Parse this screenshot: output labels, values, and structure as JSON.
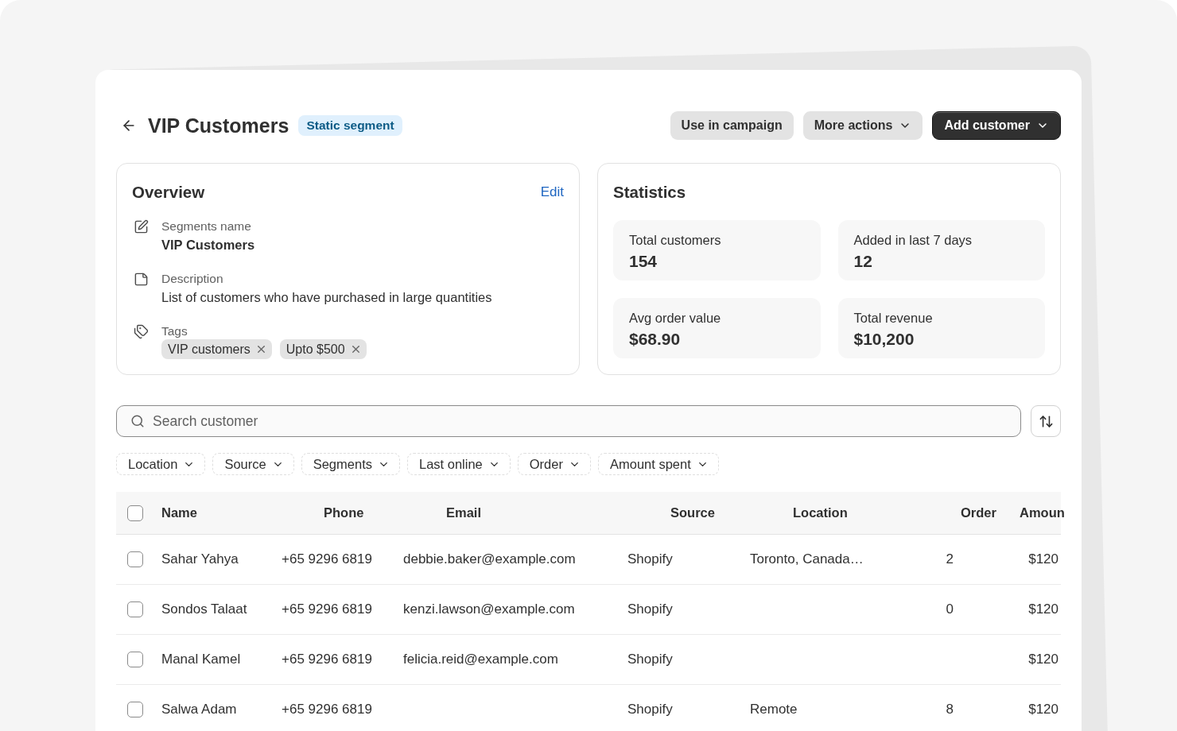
{
  "header": {
    "title": "VIP Customers",
    "badge": "Static segment",
    "actions": [
      {
        "label": "Use in campaign",
        "kind": "secondary",
        "caret": false
      },
      {
        "label": "More actions",
        "kind": "secondary",
        "caret": true
      },
      {
        "label": "Add customer",
        "kind": "primary",
        "caret": true
      }
    ]
  },
  "overview": {
    "title": "Overview",
    "edit_link": "Edit",
    "fields": [
      {
        "kind": "name",
        "label": "Segments name",
        "value": "VIP Customers"
      },
      {
        "kind": "description",
        "label": "Description",
        "value": "List of customers who have purchased in large quantities"
      },
      {
        "kind": "tags",
        "label": "Tags",
        "tags": [
          "VIP customers",
          "Upto $500"
        ]
      }
    ]
  },
  "statistics": {
    "title": "Statistics",
    "tiles": [
      {
        "label": "Total customers",
        "value": "154"
      },
      {
        "label": "Added in last 7 days",
        "value": "12"
      },
      {
        "label": "Avg order value",
        "value": "$68.90"
      },
      {
        "label": "Total revenue",
        "value": "$10,200"
      }
    ]
  },
  "search": {
    "placeholder": "Search customer"
  },
  "filters": [
    "Location",
    "Source",
    "Segments",
    "Last online",
    "Order",
    "Amount spent"
  ],
  "table": {
    "all_checked": false,
    "columns": [
      "Name",
      "Phone",
      "Email",
      "Source",
      "Location",
      "Order",
      "Amoun"
    ],
    "rows": [
      {
        "checked": false,
        "name": "Sahar Yahya",
        "phone": "+65 9296 6819",
        "email": "debbie.baker@example.com",
        "source": "Shopify",
        "location": "Toronto, Canada…",
        "order": "2",
        "amount": "$120"
      },
      {
        "checked": false,
        "name": "Sondos Talaat",
        "phone": "+65 9296 6819",
        "email": "kenzi.lawson@example.com",
        "source": "Shopify",
        "order": "0",
        "amount": "$120"
      },
      {
        "checked": false,
        "name": "Manal Kamel",
        "phone": "+65 9296 6819",
        "email": "felicia.reid@example.com",
        "source": "Shopify",
        "amount": "$120"
      },
      {
        "checked": false,
        "name": "Salwa Adam",
        "phone": "+65 9296 6819",
        "source": "Shopify",
        "location": "Remote",
        "order": "8",
        "amount": "$120"
      }
    ]
  }
}
